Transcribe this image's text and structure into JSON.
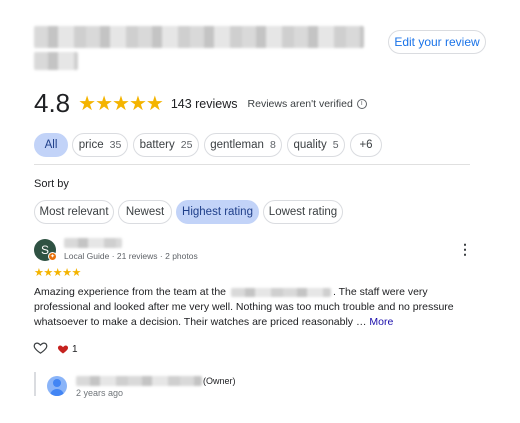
{
  "header": {
    "edit_review_label": "Edit your review"
  },
  "summary": {
    "rating": "4.8",
    "stars": "★★★★★",
    "reviews_count": "143 reviews",
    "not_verified": "Reviews aren't verified",
    "info_glyph": "i"
  },
  "topics": [
    {
      "label": "All",
      "count": ""
    },
    {
      "label": "price",
      "count": "35"
    },
    {
      "label": "battery",
      "count": "25"
    },
    {
      "label": "gentleman",
      "count": "8"
    },
    {
      "label": "quality",
      "count": "5"
    },
    {
      "label": "+6",
      "count": ""
    }
  ],
  "sort": {
    "label": "Sort by",
    "options": [
      "Most relevant",
      "Newest",
      "Highest rating",
      "Lowest rating"
    ],
    "selected": "Highest rating"
  },
  "review": {
    "avatar_letter": "S",
    "guide_info": "Local Guide · 21 reviews · 2 photos",
    "stars": "★★★★★",
    "text_part1": "Amazing experience from the team at the",
    "text_part2": ". The staff were very professional and looked after me very well. Nothing was too much trouble and no pressure whatsoever to make a decision. Their watches are priced reasonably … ",
    "more_label": "More",
    "likes": "1",
    "menu_glyph": "⋮"
  },
  "owner_reply": {
    "tag": "(Owner)",
    "time": "2 years ago"
  },
  "colors": {
    "accent": "#1a73e8",
    "star": "#f4b400",
    "chip_active": "#c2d3f8",
    "heart": "#c5221f"
  }
}
